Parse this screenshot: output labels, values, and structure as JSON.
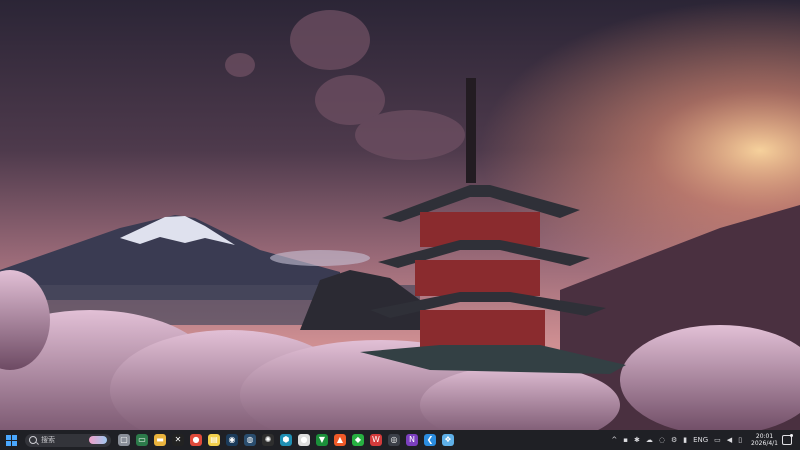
{
  "wallpaper": {
    "subject": "pagoda-fuji-cherry-blossoms"
  },
  "taskbar": {
    "search_placeholder": "搜索",
    "apps": [
      {
        "name": "task-view-icon",
        "color": "#8a8f99",
        "glyph": "▢"
      },
      {
        "name": "terminal-icon",
        "color": "#2c7a4a",
        "glyph": "▭"
      },
      {
        "name": "file-explorer-icon",
        "color": "#e9b33d",
        "glyph": "▬"
      },
      {
        "name": "capcut-icon",
        "color": "#222222",
        "glyph": "✕"
      },
      {
        "name": "chrome-icon",
        "color": "#e04a3a",
        "glyph": "●"
      },
      {
        "name": "notes-icon",
        "color": "#f2d04c",
        "glyph": "▤"
      },
      {
        "name": "steam-icon",
        "color": "#1b3b5a",
        "glyph": "◉"
      },
      {
        "name": "steam-alt-icon",
        "color": "#2a4d6e",
        "glyph": "◍"
      },
      {
        "name": "openai-icon",
        "color": "#2e2e2e",
        "glyph": "✺"
      },
      {
        "name": "shield-icon",
        "color": "#1f8fb4",
        "glyph": "⬢"
      },
      {
        "name": "github-icon",
        "color": "#dddddd",
        "glyph": "●"
      },
      {
        "name": "vim-icon",
        "color": "#1b8f3a",
        "glyph": "▼"
      },
      {
        "name": "brave-icon",
        "color": "#f05a28",
        "glyph": "▲"
      },
      {
        "name": "wechat-icon",
        "color": "#27b041",
        "glyph": "◆"
      },
      {
        "name": "wps-icon",
        "color": "#d33b3b",
        "glyph": "W"
      },
      {
        "name": "obs-icon",
        "color": "#3b3f48",
        "glyph": "◎"
      },
      {
        "name": "onenote-icon",
        "color": "#7b3fbf",
        "glyph": "N"
      },
      {
        "name": "vscode-icon",
        "color": "#2b8de0",
        "glyph": "❮"
      },
      {
        "name": "copilot-icon",
        "color": "#5fb0e8",
        "glyph": "❖"
      }
    ],
    "tray": {
      "lang": "ENG",
      "time": "20:01",
      "date": "2026/4/1"
    }
  }
}
